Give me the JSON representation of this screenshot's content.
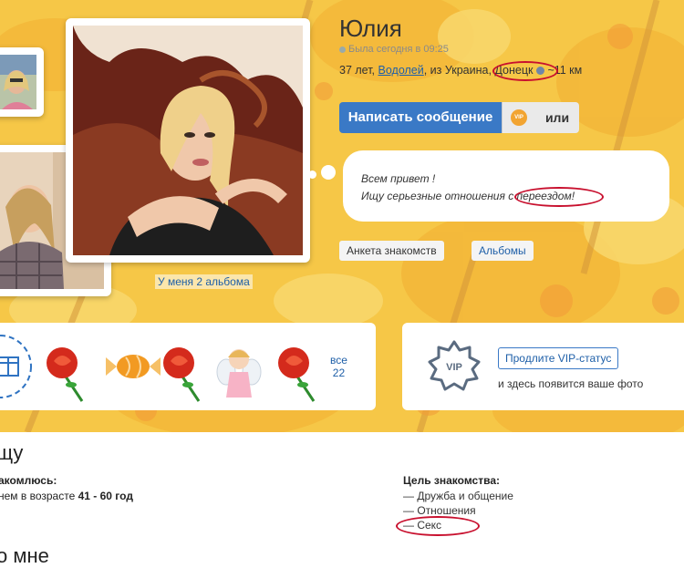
{
  "profile": {
    "name": "Юлия",
    "last_seen": "Была сегодня в 09:25",
    "age": "37 лет,",
    "zodiac": "Водолей",
    "from_text": ", из Украина,",
    "city": "Донецк",
    "distance": "~11 км"
  },
  "actions": {
    "write_message": "Написать сообщение",
    "vip_badge": "VIP",
    "or": "или"
  },
  "status_text": {
    "line1": "Всем привет !",
    "line2": "Ищу серьезные отношения с переездом!"
  },
  "tabs": {
    "anketa": "Анкета знакомств",
    "albums": "Альбомы"
  },
  "albums_link": "У меня 2 альбома",
  "gifts": {
    "all_label": "все",
    "count": "22",
    "items": [
      "gift-box-icon",
      "rose-icon",
      "candy-icon",
      "rose-icon",
      "angel-icon",
      "rose-icon"
    ]
  },
  "vip": {
    "badge": "VIP",
    "button": "Продлите VIP-статус",
    "note": "и здесь появится ваше фото"
  },
  "search": {
    "heading": "щу",
    "meet_label": "акомлюсь:",
    "meet_value_prefix": "нем в возрасте",
    "meet_value_range": "41 - 60 год",
    "goal_label": "Цель знакомства:",
    "goals": [
      "— Дружба и общение",
      "— Отношения",
      "— Секс"
    ]
  },
  "about_heading": "о мне",
  "colors": {
    "accent": "#3a79c6",
    "link": "#1e5fa8",
    "annotation": "#c8102e",
    "background": "#f5c53e"
  }
}
